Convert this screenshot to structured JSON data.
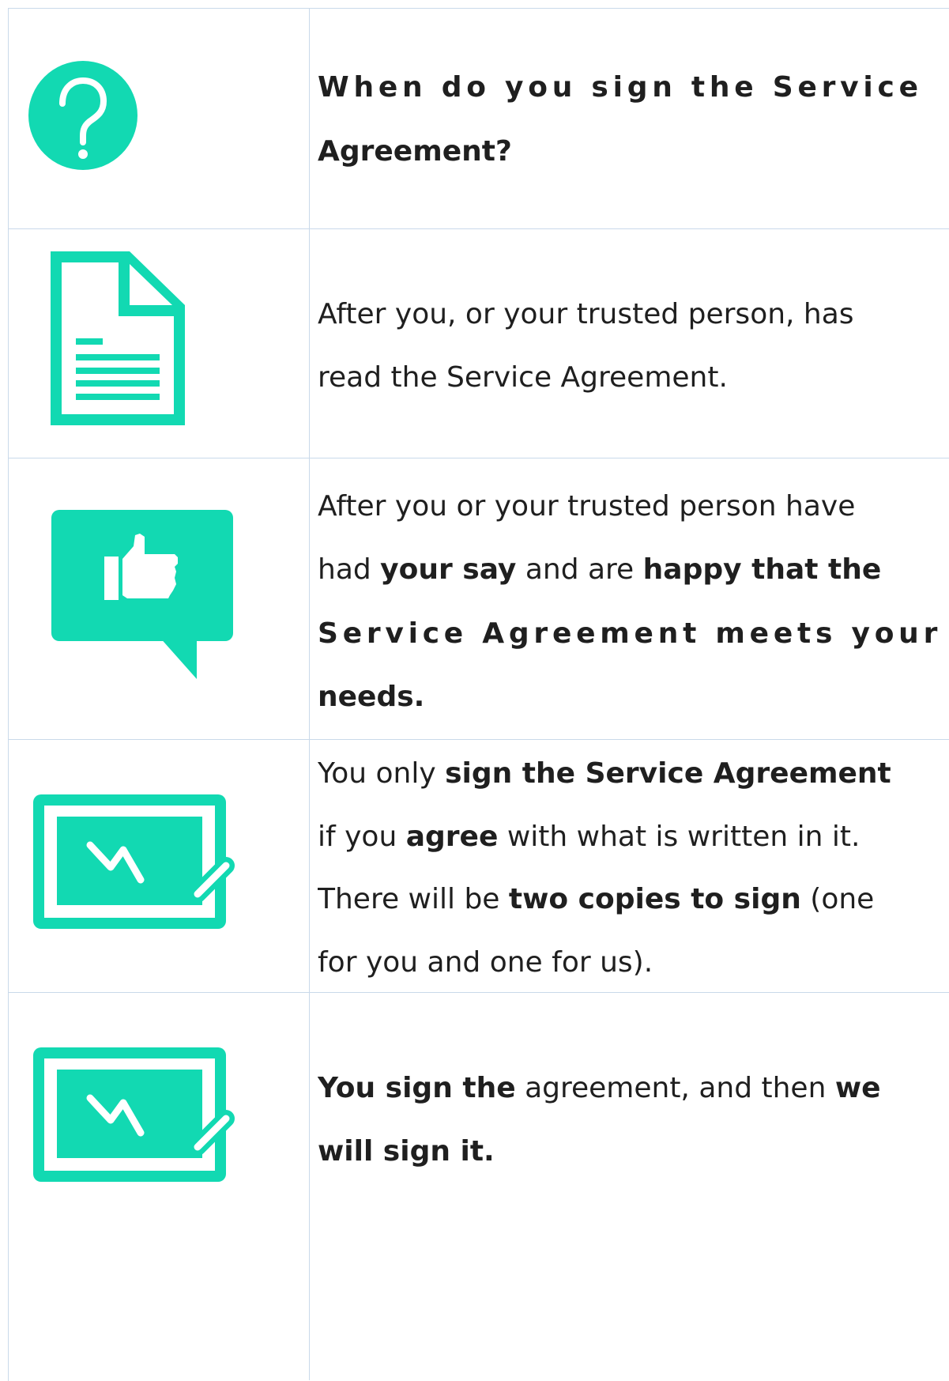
{
  "accent_color": "#12d9b2",
  "rows": [
    {
      "icon": "question-icon",
      "lines": [
        [
          {
            "t": "When do you sign the Service",
            "b": true,
            "spaced": true
          }
        ],
        [
          {
            "t": "Agreement?",
            "b": true
          }
        ]
      ]
    },
    {
      "icon": "document-icon",
      "lines": [
        [
          {
            "t": "After you, or your trusted person, has",
            "b": false
          }
        ],
        [
          {
            "t": "read the Service Agreement.",
            "b": false
          }
        ]
      ]
    },
    {
      "icon": "thumbs-up-speech-icon",
      "lines": [
        [
          {
            "t": "After you or your trusted person have",
            "b": false
          }
        ],
        [
          {
            "t": "had ",
            "b": false
          },
          {
            "t": "your say",
            "b": true
          },
          {
            "t": " and are ",
            "b": false
          },
          {
            "t": "happy that the",
            "b": true
          }
        ],
        [
          {
            "t": "Service Agreement meets your",
            "b": true,
            "spaced": true
          }
        ],
        [
          {
            "t": "needs.",
            "b": true
          }
        ]
      ]
    },
    {
      "icon": "signature-icon",
      "lines": [
        [
          {
            "t": "You only ",
            "b": false
          },
          {
            "t": "sign the Service Agreement",
            "b": true
          }
        ],
        [
          {
            "t": "if you ",
            "b": false
          },
          {
            "t": "agree",
            "b": true
          },
          {
            "t": " with what is written in it.",
            "b": false
          }
        ],
        [
          {
            "t": "There will be ",
            "b": false
          },
          {
            "t": "two copies to sign",
            "b": true
          },
          {
            "t": " (one",
            "b": false
          }
        ],
        [
          {
            "t": "for you and one for us).",
            "b": false
          }
        ]
      ]
    },
    {
      "icon": "signature-icon",
      "lines": [
        [
          {
            "t": "You sign the",
            "b": true
          },
          {
            "t": " agreement, and then ",
            "b": false
          },
          {
            "t": "we",
            "b": true
          }
        ],
        [
          {
            "t": "will sign it.",
            "b": true
          }
        ]
      ]
    }
  ]
}
